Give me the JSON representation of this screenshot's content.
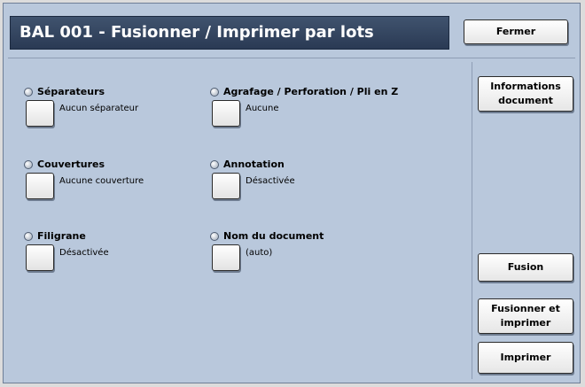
{
  "header": {
    "title": "BAL 001 - Fusionner / Imprimer par lots",
    "close_label": "Fermer"
  },
  "side_buttons": {
    "info_line1": "Informations",
    "info_line2": "document",
    "fusion_label": "Fusion",
    "fuse_print_line1": "Fusionner et",
    "fuse_print_line2": "imprimer",
    "print_label": "Imprimer"
  },
  "options": [
    {
      "label": "Séparateurs",
      "value": "Aucun séparateur"
    },
    {
      "label": "Couvertures",
      "value": "Aucune couverture"
    },
    {
      "label": "Filigrane",
      "value": "Désactivée"
    },
    {
      "label": "Agrafage / Perforation / Pli en Z",
      "value": "Aucune"
    },
    {
      "label": "Annotation",
      "value": "Désactivée"
    },
    {
      "label": "Nom du document",
      "value": "(auto)"
    }
  ]
}
